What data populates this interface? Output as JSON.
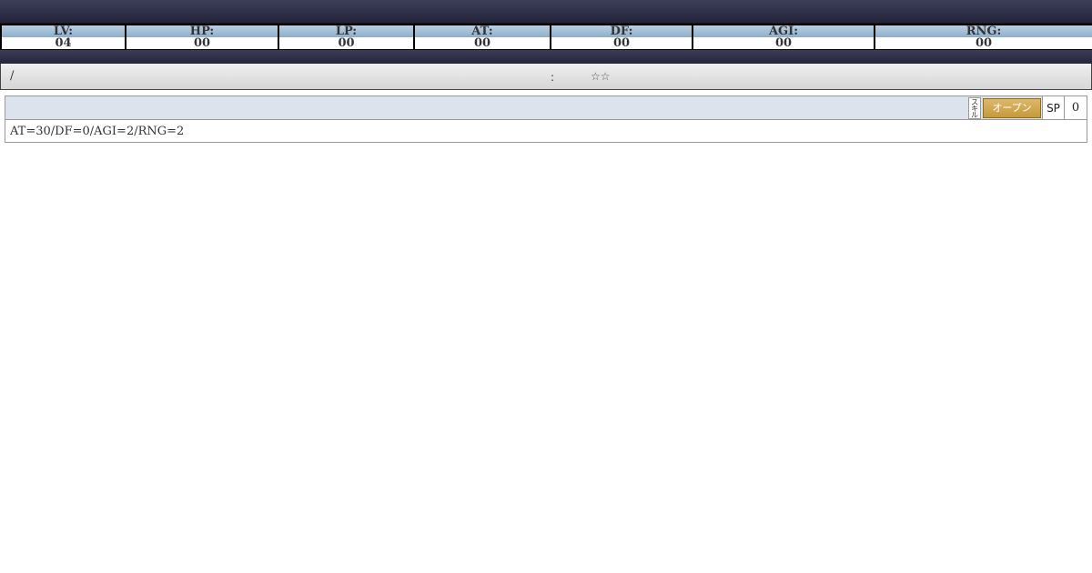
{
  "stats": [
    {
      "label": "LV:",
      "value": "04"
    },
    {
      "label": "HP:",
      "value": "00"
    },
    {
      "label": "LP:",
      "value": "00"
    },
    {
      "label": "AT:",
      "value": "00"
    },
    {
      "label": "DF:",
      "value": "00"
    },
    {
      "label": "AGI:",
      "value": "00"
    },
    {
      "label": "RNG:",
      "value": "00"
    }
  ],
  "info_bar": {
    "slash": "/",
    "colon": ":",
    "stars": "☆☆"
  },
  "skill": {
    "tag": "スキル",
    "open_button": "オープン",
    "sp_label": "SP",
    "sp_value": "0",
    "description": "AT=30/DF=0/AGI=2/RNG=2"
  },
  "colors": {
    "header_bar": "#2f3048",
    "stat_header": "#a4bfd7",
    "open_button": "#d1a955",
    "skill_header": "#dce3ec"
  }
}
